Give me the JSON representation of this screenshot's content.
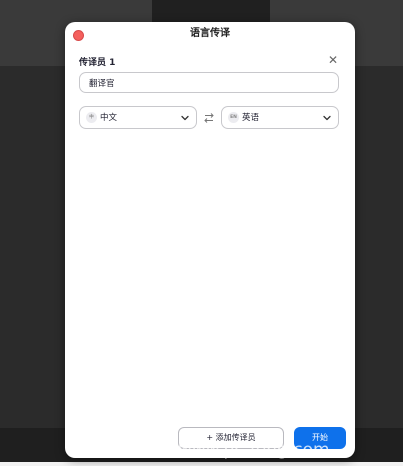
{
  "dialog": {
    "title": "语言传译",
    "interpreter": {
      "section_title": "传译员 1",
      "name_value": "翻译官",
      "source_language": {
        "badge": "中",
        "label": "中文"
      },
      "target_language": {
        "badge": "EN",
        "label": "英语"
      }
    },
    "add_button_label": "+ 添加传译员",
    "start_button_label": "开始"
  },
  "watermark": "www.pc-feng.com",
  "icons": {
    "close_dot": "close-dot-icon",
    "close_x": "close-icon",
    "chevron": "chevron-down-icon",
    "swap": "swap-arrows-icon"
  },
  "colors": {
    "primary": "#0e71eb",
    "close_dot": "#f4605d",
    "border": "#c8c8cc"
  }
}
